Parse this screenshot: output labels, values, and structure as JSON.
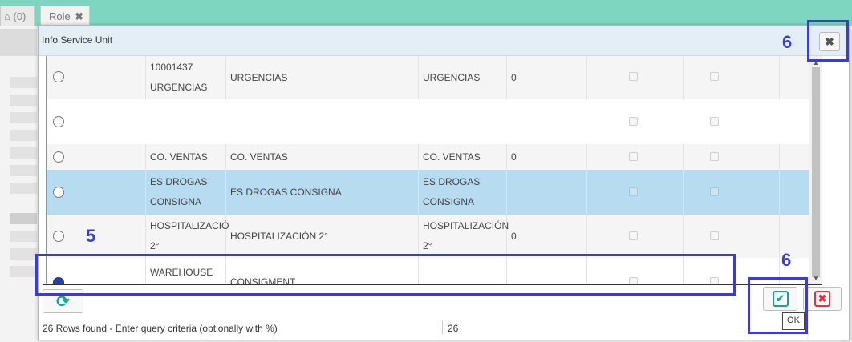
{
  "tabs": [
    {
      "label": "(0)",
      "icon": "home-icon"
    },
    {
      "label": "Role",
      "close": "✖"
    }
  ],
  "dialog": {
    "title": "Info Service Unit",
    "close_glyph": "✖"
  },
  "rows": [
    {
      "code": [
        "10001437",
        "URGENCIAS"
      ],
      "name": "URGENCIAS",
      "description": [
        "URGENCIAS"
      ],
      "number": "0",
      "selected": false
    },
    {
      "code": [
        ""
      ],
      "name": "",
      "description": [
        ""
      ],
      "number": "",
      "selected": false
    },
    {
      "code": [
        "CO. VENTAS"
      ],
      "name": "CO. VENTAS",
      "description": [
        "CO. VENTAS"
      ],
      "number": "0",
      "selected": false
    },
    {
      "code": [
        "ES DROGAS",
        "CONSIGNA"
      ],
      "name": "ES DROGAS CONSIGNA",
      "description": [
        "ES DROGAS",
        "CONSIGNA"
      ],
      "number": "",
      "selected": false
    },
    {
      "code": [
        "HOSPITALIZACIÓ",
        "2°"
      ],
      "name": "HOSPITALIZACIÓN 2°",
      "description": [
        "HOSPITALIZACIÓN",
        "2°"
      ],
      "number": "0",
      "selected": false
    },
    {
      "code": [
        "WAREHOUSE"
      ],
      "name": "CONSIGMENT",
      "description": [
        ""
      ],
      "number": "",
      "selected": true
    }
  ],
  "status": {
    "text": "26 Rows found - Enter query criteria (optionally with %)",
    "count": "26"
  },
  "buttons": {
    "ok_tooltip": "OK",
    "ok_glyph": "✔",
    "cancel_glyph": "✖",
    "refresh_glyph": "⟳"
  },
  "annotations": [
    {
      "label": "5"
    },
    {
      "label": "6"
    },
    {
      "label": "6"
    }
  ],
  "colors": {
    "accent": "#1ea38a",
    "selection": "#b7dcf2",
    "annotation": "#3b3fc7",
    "cancel": "#d9363e"
  }
}
